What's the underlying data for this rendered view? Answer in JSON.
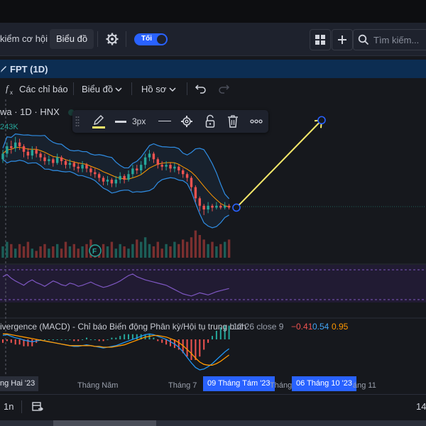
{
  "header": {
    "compare_label": "kiểm cơ hội",
    "chart_tab_label": "Biểu đồ",
    "theme_toggle_label": "Tối",
    "search_placeholder": "Tìm kiếm..."
  },
  "symbol_bar": {
    "title": "FPT (1D)"
  },
  "toolbar": {
    "indicators_label": "Các chỉ báo",
    "chart_type_label": "Biểu đồ",
    "profile_label": "Hồ sơ"
  },
  "chart_legend": {
    "symbol_line": "wa · 1D · HNX",
    "volume_value": "243K"
  },
  "drawing_toolbar": {
    "stroke_width": "3px"
  },
  "macd": {
    "title": "ivergence (MACD) - Chỉ báo Biến động Phân kỳ/Hội tụ trung bình",
    "params": "12 26 close 9",
    "macd_value": "−0.41",
    "signal_value": "0.54",
    "histogram_value": "0.95"
  },
  "time_axis": {
    "labels": [
      "ng Hai '23",
      "Tháng Năm",
      "Tháng 7",
      "09 Tháng Tám '23",
      "Tháng 9",
      "06 Tháng 10 '23",
      "áng 11"
    ]
  },
  "bottom": {
    "interval_label": "1n",
    "right_label": "14"
  },
  "colors": {
    "accent": "#2962ff",
    "up": "#26a69a",
    "down": "#ef5350",
    "trendline": "#f7e96a",
    "bollinger": "#2f8de4",
    "basis": "#ff9800",
    "rsi": "#7e57c2"
  },
  "icons": {
    "function": "fx-icon",
    "gear": "gear-icon",
    "grid": "layout-grid-icon",
    "plus": "plus-icon",
    "search": "search-icon",
    "pencil": "pencil-icon",
    "lock": "lock-open-icon",
    "trash": "trash-icon",
    "more": "more-icon",
    "undo": "undo-icon",
    "redo": "redo-icon",
    "date": "date-range-icon"
  },
  "chart_data": {
    "type": "candlestick",
    "series": [
      {
        "name": "FPT price",
        "values": [
          {
            "o": 63,
            "c": 66,
            "h": 68,
            "l": 61
          },
          {
            "o": 66,
            "c": 70,
            "h": 72,
            "l": 64
          },
          {
            "o": 70,
            "c": 69,
            "h": 73,
            "l": 66
          },
          {
            "o": 69,
            "c": 72,
            "h": 75,
            "l": 67
          },
          {
            "o": 72,
            "c": 70,
            "h": 74,
            "l": 68
          },
          {
            "o": 70,
            "c": 67,
            "h": 71,
            "l": 64
          },
          {
            "o": 67,
            "c": 65,
            "h": 69,
            "l": 63
          },
          {
            "o": 65,
            "c": 68,
            "h": 70,
            "l": 63
          },
          {
            "o": 68,
            "c": 66,
            "h": 70,
            "l": 64
          },
          {
            "o": 66,
            "c": 64,
            "h": 67,
            "l": 62
          },
          {
            "o": 64,
            "c": 62,
            "h": 66,
            "l": 60
          },
          {
            "o": 62,
            "c": 63,
            "h": 65,
            "l": 60
          },
          {
            "o": 63,
            "c": 61,
            "h": 64,
            "l": 59
          },
          {
            "o": 61,
            "c": 64,
            "h": 66,
            "l": 60
          },
          {
            "o": 64,
            "c": 62,
            "h": 65,
            "l": 60
          },
          {
            "o": 62,
            "c": 60,
            "h": 63,
            "l": 58
          },
          {
            "o": 60,
            "c": 61,
            "h": 63,
            "l": 58
          },
          {
            "o": 61,
            "c": 59,
            "h": 62,
            "l": 57
          },
          {
            "o": 59,
            "c": 58,
            "h": 61,
            "l": 56
          },
          {
            "o": 58,
            "c": 60,
            "h": 62,
            "l": 56
          },
          {
            "o": 60,
            "c": 58,
            "h": 61,
            "l": 56
          },
          {
            "o": 58,
            "c": 56,
            "h": 59,
            "l": 54
          },
          {
            "o": 56,
            "c": 55,
            "h": 58,
            "l": 53
          },
          {
            "o": 55,
            "c": 53,
            "h": 56,
            "l": 51
          },
          {
            "o": 53,
            "c": 51,
            "h": 54,
            "l": 49
          },
          {
            "o": 51,
            "c": 52,
            "h": 54,
            "l": 49
          },
          {
            "o": 52,
            "c": 50,
            "h": 53,
            "l": 48
          },
          {
            "o": 50,
            "c": 52,
            "h": 54,
            "l": 48
          },
          {
            "o": 52,
            "c": 54,
            "h": 56,
            "l": 50
          },
          {
            "o": 54,
            "c": 52,
            "h": 55,
            "l": 50
          },
          {
            "o": 52,
            "c": 55,
            "h": 57,
            "l": 51
          },
          {
            "o": 55,
            "c": 58,
            "h": 60,
            "l": 53
          },
          {
            "o": 58,
            "c": 57,
            "h": 60,
            "l": 55
          },
          {
            "o": 57,
            "c": 60,
            "h": 62,
            "l": 55
          },
          {
            "o": 60,
            "c": 64,
            "h": 66,
            "l": 58
          },
          {
            "o": 64,
            "c": 66,
            "h": 68,
            "l": 62
          },
          {
            "o": 66,
            "c": 63,
            "h": 67,
            "l": 61
          },
          {
            "o": 63,
            "c": 60,
            "h": 64,
            "l": 58
          },
          {
            "o": 60,
            "c": 59,
            "h": 62,
            "l": 57
          },
          {
            "o": 59,
            "c": 60,
            "h": 62,
            "l": 57
          },
          {
            "o": 60,
            "c": 58,
            "h": 61,
            "l": 56
          },
          {
            "o": 58,
            "c": 59,
            "h": 61,
            "l": 56
          },
          {
            "o": 59,
            "c": 57,
            "h": 60,
            "l": 55
          },
          {
            "o": 57,
            "c": 55,
            "h": 58,
            "l": 53
          },
          {
            "o": 55,
            "c": 53,
            "h": 56,
            "l": 51
          },
          {
            "o": 53,
            "c": 48,
            "h": 54,
            "l": 46
          },
          {
            "o": 48,
            "c": 42,
            "h": 49,
            "l": 40
          },
          {
            "o": 42,
            "c": 38,
            "h": 43,
            "l": 35
          },
          {
            "o": 38,
            "c": 36,
            "h": 39,
            "l": 33
          },
          {
            "o": 36,
            "c": 38,
            "h": 40,
            "l": 34
          },
          {
            "o": 38,
            "c": 37,
            "h": 39,
            "l": 35
          },
          {
            "o": 37,
            "c": 38,
            "h": 40,
            "l": 36
          },
          {
            "o": 38,
            "c": 37,
            "h": 39,
            "l": 36
          },
          {
            "o": 37,
            "c": 38,
            "h": 40,
            "l": 36
          },
          {
            "o": 38,
            "c": 37,
            "h": 39,
            "l": 36
          }
        ]
      }
    ],
    "trendline": {
      "from": {
        "bar": 54,
        "price": 37
      },
      "to": {
        "bar": 71,
        "price": 84
      }
    },
    "volume": [
      5,
      7,
      6,
      4,
      6,
      5,
      7,
      4,
      3,
      5,
      6,
      4,
      5,
      6,
      4,
      7,
      5,
      6,
      4,
      5,
      6,
      8,
      5,
      4,
      6,
      5,
      7,
      4,
      6,
      5,
      4,
      6,
      8,
      7,
      9,
      6,
      5,
      7,
      4,
      6,
      5,
      7,
      6,
      8,
      7,
      9,
      12,
      10,
      8,
      6,
      7,
      5,
      6,
      7,
      8
    ],
    "rsi": [
      58,
      62,
      55,
      50,
      46,
      42,
      48,
      52,
      47,
      44,
      40,
      45,
      50,
      47,
      43,
      41,
      46,
      44,
      40,
      42,
      45,
      48,
      44,
      41,
      38,
      40,
      43,
      46,
      50,
      55,
      60,
      63,
      58,
      55,
      52,
      50,
      48,
      46,
      44,
      42,
      38,
      34,
      30,
      26,
      24,
      22,
      25,
      28,
      26,
      24,
      27,
      30,
      32,
      34,
      36
    ],
    "macd": [
      0.5,
      0.6,
      0.4,
      0.2,
      0.1,
      -0.1,
      -0.2,
      -0.3,
      -0.2,
      -0.1,
      -0.2,
      -0.3,
      -0.4,
      -0.5,
      -0.6,
      -0.7,
      -0.8,
      -0.9,
      -0.9,
      -0.8,
      -0.7,
      -0.8,
      -0.9,
      -1.0,
      -1.1,
      -1.0,
      -0.9,
      -0.8,
      -0.6,
      -0.4,
      -0.2,
      0.0,
      0.2,
      0.4,
      0.6,
      0.7,
      0.6,
      0.4,
      0.2,
      0.0,
      -0.3,
      -0.6,
      -1.0,
      -1.6,
      -2.3,
      -3.0,
      -3.6,
      -3.9,
      -3.8,
      -3.5,
      -3.1,
      -2.6,
      -2.1,
      -1.6,
      -1.2
    ],
    "signal": [
      0.7,
      0.7,
      0.6,
      0.5,
      0.4,
      0.3,
      0.2,
      0.1,
      0.0,
      -0.1,
      -0.2,
      -0.3,
      -0.4,
      -0.5,
      -0.6,
      -0.7,
      -0.8,
      -0.8,
      -0.8,
      -0.8,
      -0.8,
      -0.8,
      -0.9,
      -0.9,
      -1.0,
      -1.0,
      -1.0,
      -0.9,
      -0.8,
      -0.7,
      -0.5,
      -0.3,
      -0.1,
      0.1,
      0.3,
      0.4,
      0.5,
      0.5,
      0.4,
      0.3,
      0.1,
      -0.1,
      -0.4,
      -0.8,
      -1.3,
      -1.8,
      -2.4,
      -2.9,
      -3.2,
      -3.3,
      -3.3,
      -3.1,
      -2.8,
      -2.4,
      -2.0
    ]
  }
}
